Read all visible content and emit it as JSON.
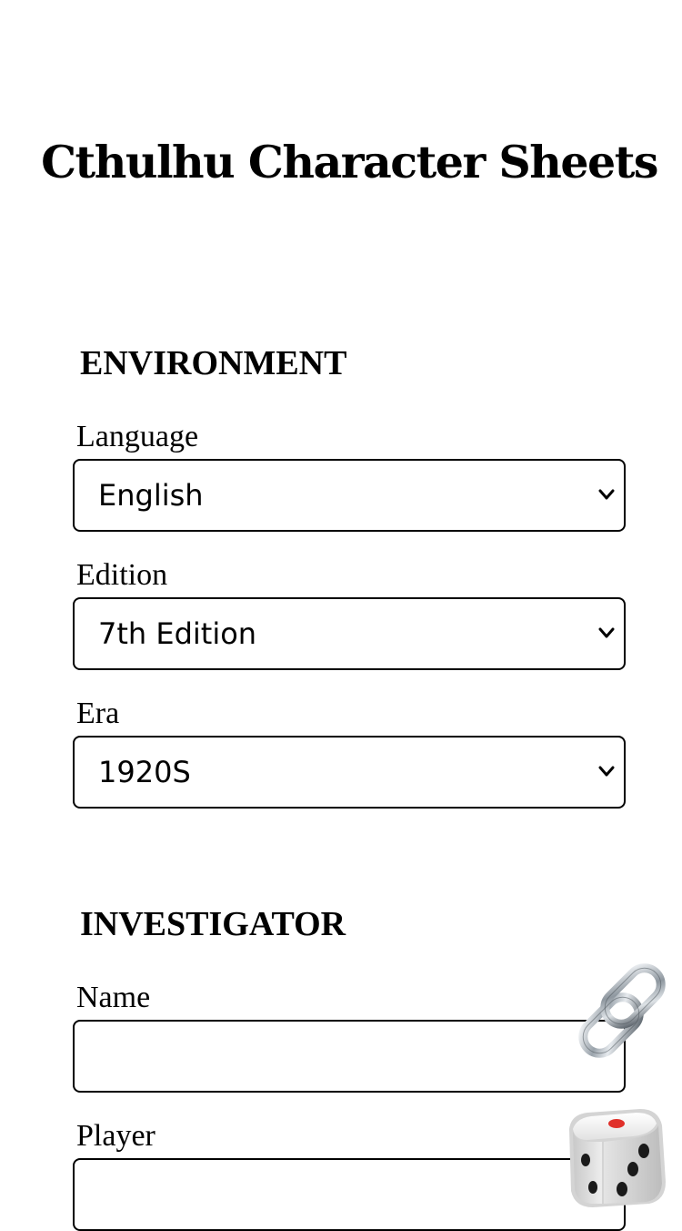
{
  "header": {
    "title": "Cthulhu Character Sheets"
  },
  "environment": {
    "section_title": "ENVIRONMENT",
    "language": {
      "label": "Language",
      "value": "English"
    },
    "edition": {
      "label": "Edition",
      "value": "7th Edition"
    },
    "era": {
      "label": "Era",
      "value": "1920S"
    }
  },
  "investigator": {
    "section_title": "INVESTIGATOR",
    "name": {
      "label": "Name",
      "value": ""
    },
    "player": {
      "label": "Player",
      "value": ""
    }
  },
  "floating_actions": {
    "link_icon": "link-icon",
    "dice_icon": "dice-icon"
  },
  "colors": {
    "text": "#000000",
    "border": "#000000",
    "background": "#ffffff",
    "dice_pip_accent": "#e0302a"
  }
}
